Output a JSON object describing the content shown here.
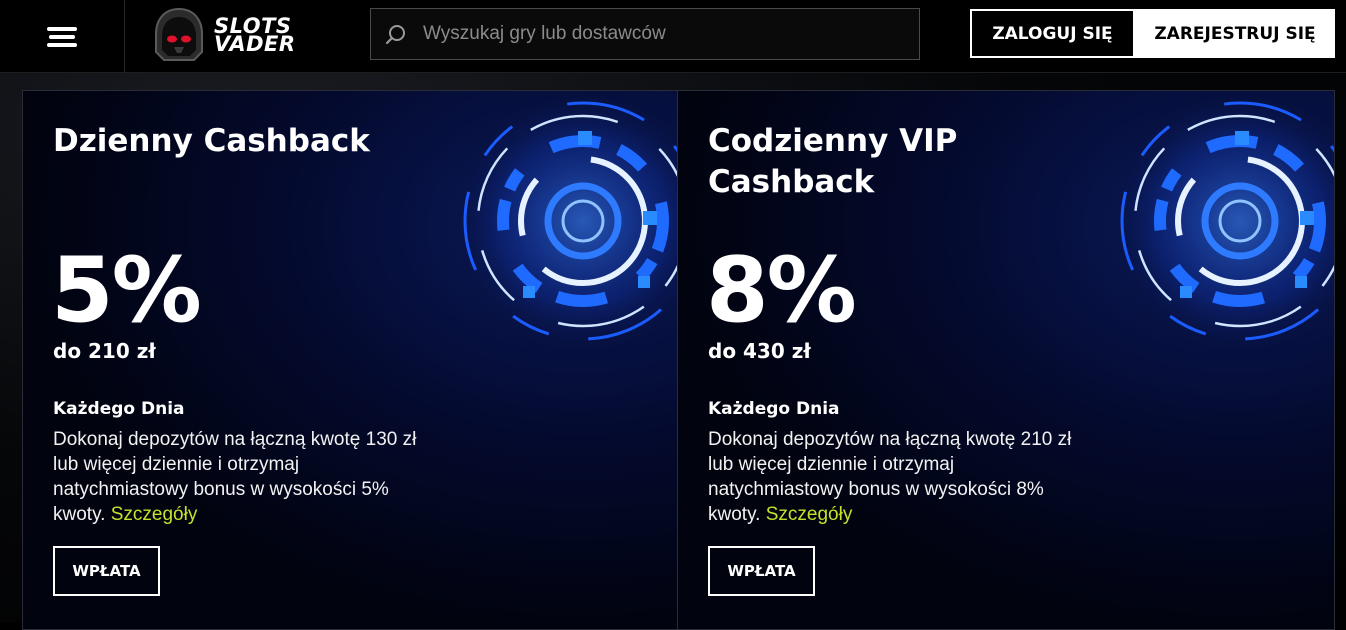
{
  "header": {
    "logo_line1": "SLOTS",
    "logo_line2": "VADER",
    "search_placeholder": "Wyszukaj gry lub dostawców",
    "login_label": "ZALOGUJ SIĘ",
    "register_label": "ZAREJESTRUJ SIĘ"
  },
  "colors": {
    "accent_link": "#c4e22a",
    "portal_blue": "#1e6bff"
  },
  "cards": [
    {
      "title": "Dzienny Cashback",
      "percent": "5%",
      "limit": "do 210 zł",
      "frequency": "Każdego Dnia",
      "description": "Dokonaj depozytów na łączną kwotę 130 zł lub więcej dziennie i otrzymaj natychmiastowy bonus w wysokości 5% kwoty.",
      "details_link": "Szczegóły",
      "button_label": "WPŁATA"
    },
    {
      "title": "Codzienny VIP Cashback",
      "percent": "8%",
      "limit": "do 430 zł",
      "frequency": "Każdego Dnia",
      "description": "Dokonaj depozytów na łączną kwotę 210 zł lub więcej dziennie i otrzymaj natychmiastowy bonus w wysokości 8% kwoty.",
      "details_link": "Szczegóły",
      "button_label": "WPŁATA"
    }
  ]
}
